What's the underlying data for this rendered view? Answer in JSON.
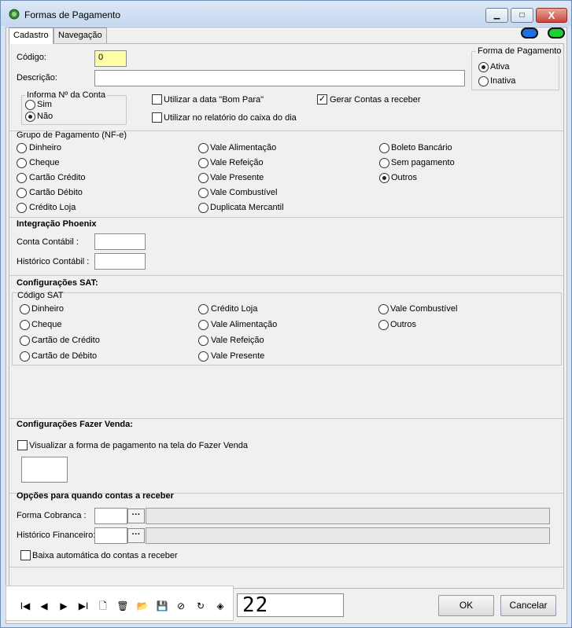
{
  "window": {
    "title": "Formas de Pagamento",
    "controls": {
      "minimize": "▁",
      "maximize": "□",
      "close": "X"
    }
  },
  "tabs": [
    {
      "label": "Cadastro",
      "active": true
    },
    {
      "label": "Navegação",
      "active": false
    }
  ],
  "leds": [
    {
      "color": "#1d6fe0"
    },
    {
      "color": "#20d030"
    }
  ],
  "form": {
    "codigo_label": "Código:",
    "codigo_value": "0",
    "descricao_label": "Descrição:",
    "descricao_value": "",
    "forma_pagamento": {
      "title": "Forma de Pagamento",
      "options": [
        "Ativa",
        "Inativa"
      ],
      "selected": "Ativa"
    },
    "informa_conta": {
      "title": "Informa Nº da Conta",
      "options": [
        "Sim",
        "Não"
      ],
      "selected": "Não"
    },
    "checks": {
      "bom_para": {
        "label": "Utilizar a data \"Bom Para\"",
        "checked": false
      },
      "gerar_contas": {
        "label": "Gerar Contas a receber",
        "checked": true
      },
      "relatorio_caixa": {
        "label": "Utilizar no relatório do caixa do dia",
        "checked": false
      }
    }
  },
  "grupo_pagamento": {
    "title": "Grupo de Pagamento (NF-e)",
    "col1": [
      "Dinheiro",
      "Cheque",
      "Cartão Crédito",
      "Cartão Débito",
      "Crédito Loja"
    ],
    "col2": [
      "Vale Alimentação",
      "Vale Refeição",
      "Vale Presente",
      "Vale Combustível",
      "Duplicata Mercantil"
    ],
    "col3": [
      "Boleto Bancário",
      "Sem pagamento",
      "Outros"
    ],
    "selected": "Outros"
  },
  "integracao": {
    "title": "Integração Phoenix",
    "conta_label": "Conta Contábil :",
    "conta_value": "",
    "historico_label": "Histórico Contábil :",
    "historico_value": ""
  },
  "sat": {
    "title": "Configurações SAT:",
    "subtitle": "Código SAT",
    "col1": [
      "Dinheiro",
      "Cheque",
      "Cartão de Crédito",
      "Cartão de Débito"
    ],
    "col2": [
      "Crédito Loja",
      "Vale Alimentação",
      "Vale Refeição",
      "Vale Presente"
    ],
    "col3": [
      "Vale Combustível",
      "Outros"
    ]
  },
  "fazer_venda": {
    "title": "Configurações Fazer Venda:",
    "visualizar_label": "Visualizar a forma de pagamento  na tela do Fazer Venda",
    "visualizar_checked": false
  },
  "contas_receber": {
    "title": "Opções para quando contas a receber",
    "forma_label": "Forma Cobranca :",
    "forma_value": "",
    "historico_label": "Histórico Financeiro:",
    "historico_value": "",
    "ellipsis": "···",
    "baixa_label": "Baixa automática do contas a receber",
    "baixa_checked": false
  },
  "toolbar": [
    {
      "icon": "first-record-icon",
      "glyph": "I◀"
    },
    {
      "icon": "prev-record-icon",
      "glyph": "◀"
    },
    {
      "icon": "next-record-icon",
      "glyph": "▶"
    },
    {
      "icon": "last-record-icon",
      "glyph": "▶I"
    },
    {
      "icon": "new-record-icon",
      "glyph": "🗋"
    },
    {
      "icon": "delete-record-icon",
      "glyph": "🗑"
    },
    {
      "icon": "open-icon",
      "glyph": "📂"
    },
    {
      "icon": "save-icon",
      "glyph": "💾"
    },
    {
      "icon": "cancel-icon",
      "glyph": "⊘"
    },
    {
      "icon": "refresh-icon",
      "glyph": "↻"
    },
    {
      "icon": "gem-icon",
      "glyph": "◈"
    }
  ],
  "record_counter": "22",
  "buttons": {
    "ok": "OK",
    "cancel": "Cancelar"
  }
}
